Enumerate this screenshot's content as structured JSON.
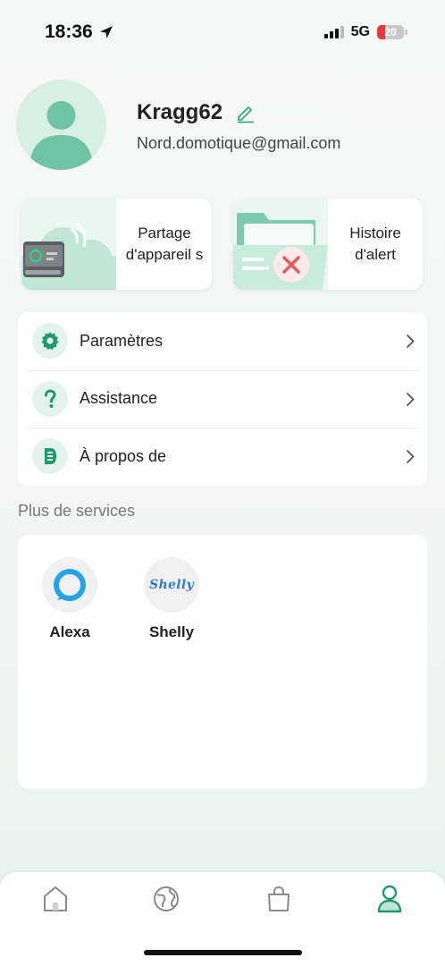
{
  "status_bar": {
    "time": "18:36",
    "network": "5G",
    "battery": "20",
    "battery_color": "#e53935"
  },
  "profile": {
    "username": "Kragg62",
    "email": "Nord.domotique@gmail.com",
    "avatar_icon": "user-avatar-icon",
    "edit_icon": "pencil-icon"
  },
  "cards": [
    {
      "label": "Partage d'appareil s",
      "icon": "cloud-device-illustration"
    },
    {
      "label": "Histoire d'alert",
      "icon": "folder-alert-illustration"
    }
  ],
  "menu": [
    {
      "label": "Paramètres",
      "icon": "gear-icon"
    },
    {
      "label": "Assistance",
      "icon": "question-icon"
    },
    {
      "label": "À propos de",
      "icon": "info-doc-icon"
    }
  ],
  "services": {
    "title": "Plus de services",
    "items": [
      {
        "label": "Alexa",
        "logo": "alexa-logo"
      },
      {
        "label": "Shelly",
        "logo": "Shelly"
      }
    ]
  },
  "tabbar": {
    "tabs": [
      "home-icon",
      "globe-icon",
      "bag-icon",
      "profile-icon"
    ],
    "active_index": 3
  },
  "colors": {
    "accent": "#1f9a6f",
    "accent_light": "#d8efe6",
    "alexa_blue": "#24a3e8",
    "shelly_blue": "#2f7bc4"
  }
}
